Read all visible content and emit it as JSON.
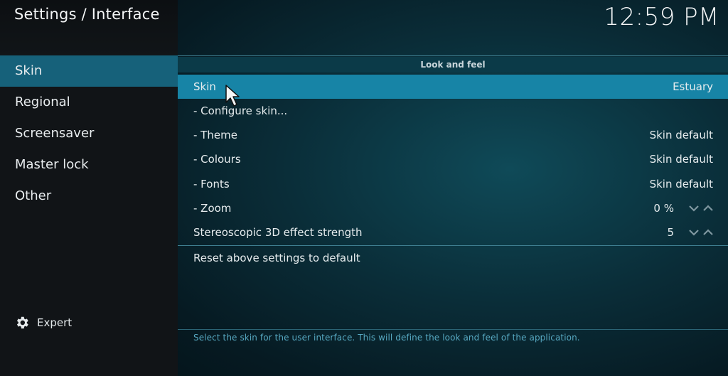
{
  "header": {
    "title": "Settings / Interface",
    "clock": "12:59 PM"
  },
  "sidebar": {
    "items": [
      {
        "label": "Skin",
        "active": true
      },
      {
        "label": "Regional",
        "active": false
      },
      {
        "label": "Screensaver",
        "active": false
      },
      {
        "label": "Master lock",
        "active": false
      },
      {
        "label": "Other",
        "active": false
      }
    ],
    "expert": {
      "label": "Expert",
      "icon": "gear-icon"
    }
  },
  "section": {
    "title": "Look and feel"
  },
  "settings": [
    {
      "label": "Skin",
      "value": "Estuary"
    },
    {
      "label": "- Configure skin...",
      "value": ""
    },
    {
      "label": "- Theme",
      "value": "Skin default"
    },
    {
      "label": "- Colours",
      "value": "Skin default"
    },
    {
      "label": "- Fonts",
      "value": "Skin default"
    },
    {
      "label": "- Zoom",
      "value": "0 %"
    },
    {
      "label": "Stereoscopic 3D effect strength",
      "value": "5"
    }
  ],
  "reset": {
    "label": "Reset above settings to default"
  },
  "help": {
    "text": "Select the skin for the user interface. This will define the look and feel of the application."
  },
  "colors": {
    "accent": "#1784a6",
    "sidebar_active": "#16617a",
    "help_text": "#57a9c2"
  }
}
